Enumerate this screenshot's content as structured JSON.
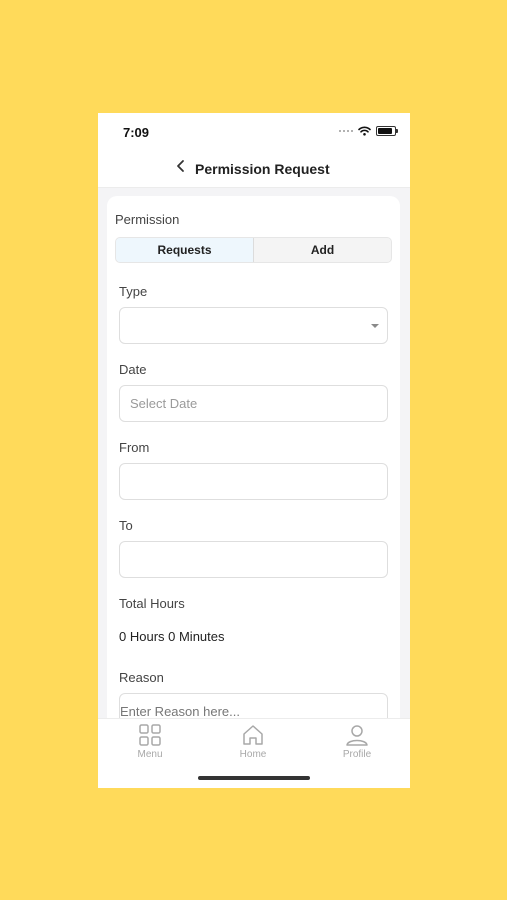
{
  "status": {
    "time": "7:09"
  },
  "header": {
    "title": "Permission Request"
  },
  "section": {
    "label": "Permission"
  },
  "segments": {
    "requests": "Requests",
    "add": "Add"
  },
  "form": {
    "type_label": "Type",
    "type_value": "",
    "date_label": "Date",
    "date_placeholder": "Select Date",
    "from_label": "From",
    "to_label": "To",
    "total_hours_label": "Total Hours",
    "total_hours_value": "0 Hours 0 Minutes",
    "reason_label": "Reason",
    "reason_placeholder": "Enter Reason here..."
  },
  "tabs": [
    {
      "label": "Menu",
      "icon": "grid-icon"
    },
    {
      "label": "Home",
      "icon": "home-icon"
    },
    {
      "label": "Profile",
      "icon": "user-icon"
    }
  ],
  "colors": {
    "background": "#FFDA5A",
    "selected_segment": "#eef7fd"
  }
}
